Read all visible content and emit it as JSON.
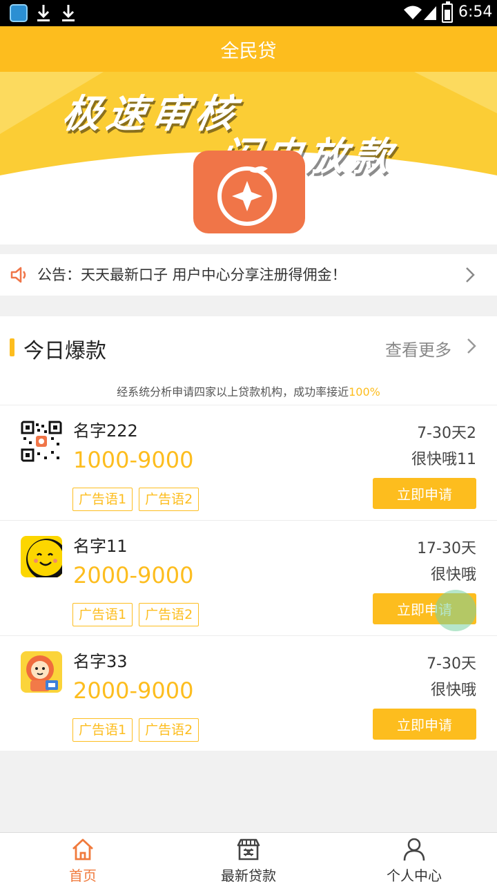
{
  "status_bar": {
    "time": "6:54",
    "icons": [
      "nox-app-icon",
      "download-icon",
      "download-icon",
      "wifi-icon",
      "signal-icon",
      "battery-icon"
    ]
  },
  "header": {
    "title": "全民贷"
  },
  "banner": {
    "line1": "极速审核",
    "line2": "闪电放款"
  },
  "notice": {
    "icon": "speaker-icon",
    "text": "公告：天天最新口子 用户中心分享注册得佣金！"
  },
  "section": {
    "title": "今日爆款",
    "more_label": "查看更多",
    "subtitle_prefix": "经系统分析申请四家以上贷款机构，成功率接近",
    "subtitle_highlight": "100%"
  },
  "products": [
    {
      "name": "名字222",
      "amount": "1000-9000",
      "tags": [
        "广告语1",
        "广告语2"
      ],
      "term": "7-30天2",
      "speed": "很快哦11",
      "apply_label": "立即申请",
      "logo": "qr-code-icon"
    },
    {
      "name": "名字11",
      "amount": "2000-9000",
      "tags": [
        "广告语1",
        "广告语2"
      ],
      "term": "17-30天",
      "speed": "很快哦",
      "apply_label": "立即申请",
      "logo": "smiley-face-icon"
    },
    {
      "name": "名字33",
      "amount": "2000-9000",
      "tags": [
        "广告语1",
        "广告语2"
      ],
      "term": "7-30天",
      "speed": "很快哦",
      "apply_label": "立即申请",
      "logo": "lion-mascot-icon"
    }
  ],
  "bottom_nav": [
    {
      "label": "首页",
      "icon": "home-icon",
      "active": true
    },
    {
      "label": "最新贷款",
      "icon": "store-icon",
      "active": false
    },
    {
      "label": "个人中心",
      "icon": "person-icon",
      "active": false
    }
  ],
  "colors": {
    "accent": "#fdbd1e",
    "active_nav": "#f07a3c",
    "app_icon": "#f07548"
  }
}
